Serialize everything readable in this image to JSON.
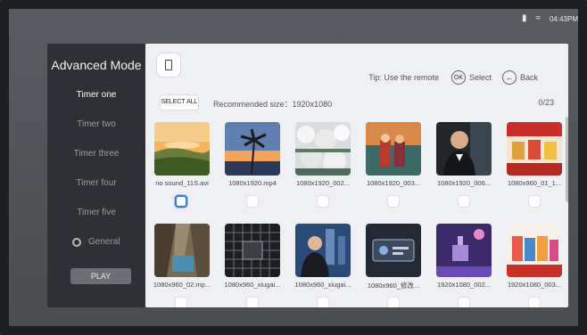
{
  "status": {
    "time": "04:43PM"
  },
  "left_panel": {
    "title": "Advanced Mode",
    "items": [
      {
        "label": "Timer one",
        "active": true
      },
      {
        "label": "Timer two",
        "active": false
      },
      {
        "label": "Timer three",
        "active": false
      },
      {
        "label": "Timer four",
        "active": false
      },
      {
        "label": "Timer five",
        "active": false
      }
    ],
    "general_label": "General",
    "play_label": "PLAY"
  },
  "right_panel": {
    "tip_prefix": "Tip: Use the remote",
    "ok_label": "OK",
    "select_label": "Select",
    "back_label": "Back",
    "select_all_label": "SELECT ALL",
    "recommended": "Recommended size：1920x1080",
    "count": "0/23",
    "files": [
      {
        "name": "no sound_11S.avi"
      },
      {
        "name": "1080x1920.mp4"
      },
      {
        "name": "1080x1920_002..."
      },
      {
        "name": "1080x1920_003..."
      },
      {
        "name": "1080x1920_006..."
      },
      {
        "name": "1080x960_01_1..."
      },
      {
        "name": "1080x960_02.mp..."
      },
      {
        "name": "1080x960_xiugai..."
      },
      {
        "name": "1080x960_xiugai..."
      },
      {
        "name": "1080x960_修改..."
      },
      {
        "name": "1920x1080_002..."
      },
      {
        "name": "1920x1080_003..."
      }
    ]
  }
}
